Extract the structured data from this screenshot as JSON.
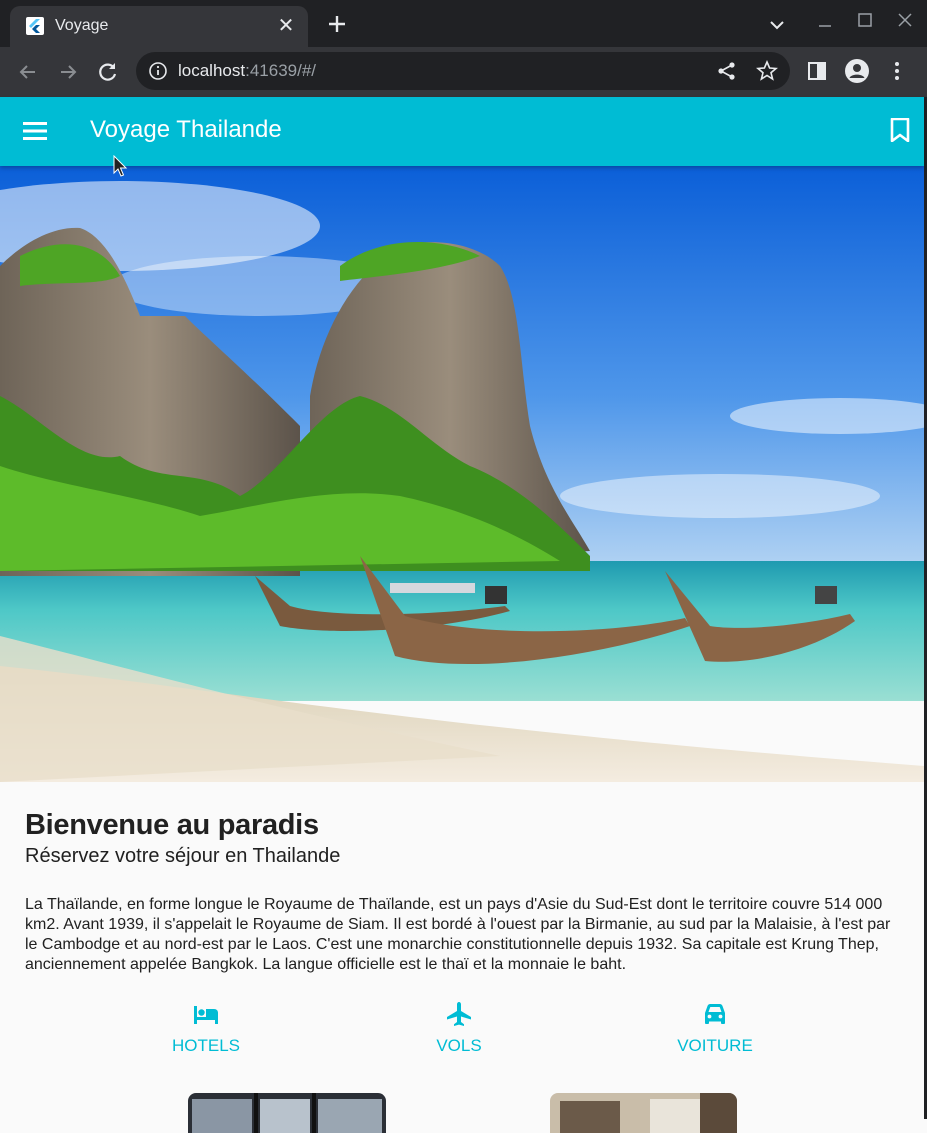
{
  "browser": {
    "tab_title": "Voyage",
    "tab_close": "✕",
    "url_host": "localhost",
    "url_rest": ":41639/#/"
  },
  "app": {
    "title": "Voyage Thailande"
  },
  "content": {
    "heading": "Bienvenue au paradis",
    "subheading": "Réservez votre séjour en Thailande",
    "description": "La Thaïlande, en forme longue le Royaume de Thaïlande, est un pays d'Asie du Sud-Est dont le territoire couvre 514 000 km2. Avant 1939, il s'appelait le Royaume de Siam. Il est bordé à l'ouest par la Birmanie, au sud par la Malaisie, à l'est par le Cambodge et au nord-est par le Laos. C'est une monarchie constitutionnelle depuis 1932. Sa capitale est Krung Thep, anciennement appelée Bangkok. La langue officielle est le thaï et la monnaie le baht."
  },
  "actions": [
    {
      "label": "HOTELS",
      "icon": "bed-icon"
    },
    {
      "label": "VOLS",
      "icon": "airplane-icon"
    },
    {
      "label": "VOITURE",
      "icon": "car-icon"
    }
  ],
  "colors": {
    "accent": "#00bcd4",
    "chrome_dark": "#202124",
    "chrome_tab": "#35363a",
    "text": "#212121"
  }
}
